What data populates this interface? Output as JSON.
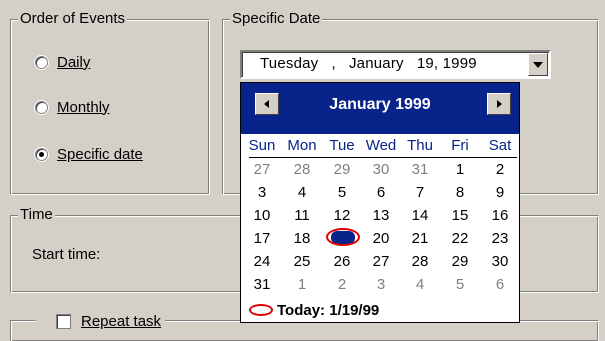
{
  "order_of_events": {
    "title": "Order of Events",
    "options": [
      {
        "label": "Daily",
        "selected": false
      },
      {
        "label": "Monthly",
        "selected": false
      },
      {
        "label": "Specific date",
        "selected": true
      }
    ]
  },
  "specific_date": {
    "title": "Specific Date",
    "value": "Tuesday   ,   January   19, 1999"
  },
  "time": {
    "title": "Time",
    "start_time_label": "Start time:"
  },
  "repeat_task": {
    "label": "Repeat task",
    "checked": false
  },
  "calendar": {
    "month_title": "January 1999",
    "weekdays": [
      "Sun",
      "Mon",
      "Tue",
      "Wed",
      "Thu",
      "Fri",
      "Sat"
    ],
    "weeks": [
      [
        "27",
        "28",
        "29",
        "30",
        "31",
        "1",
        "2"
      ],
      [
        "3",
        "4",
        "5",
        "6",
        "7",
        "8",
        "9"
      ],
      [
        "10",
        "11",
        "12",
        "13",
        "14",
        "15",
        "16"
      ],
      [
        "17",
        "18",
        "19",
        "20",
        "21",
        "22",
        "23"
      ],
      [
        "24",
        "25",
        "26",
        "27",
        "28",
        "29",
        "30"
      ],
      [
        "31",
        "1",
        "2",
        "3",
        "4",
        "5",
        "6"
      ]
    ],
    "selected_day": "19",
    "today_label": "Today: 1/19/99",
    "colors": {
      "header": "#08248a",
      "today_ring": "#e00000",
      "trailing": "#808080"
    }
  }
}
